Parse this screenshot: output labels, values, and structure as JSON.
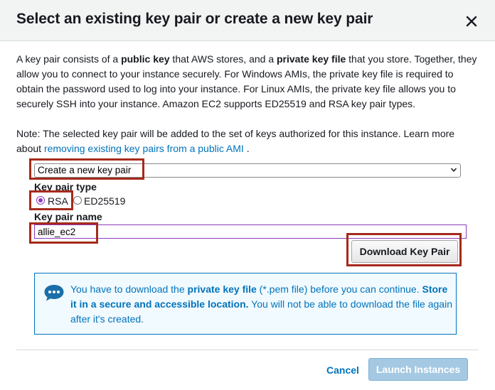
{
  "dialog": {
    "title": "Select an existing key pair or create a new key pair",
    "close_icon": "close-icon"
  },
  "description": {
    "p1_a": "A key pair consists of a ",
    "p1_b": "public key",
    "p1_c": " that AWS stores, and a ",
    "p1_d": "private key file",
    "p1_e": " that you store. Together, they allow you to connect to your instance securely. For Windows AMIs, the private key file is required to obtain the password used to log into your instance. For Linux AMIs, the private key file allows you to securely SSH into your instance. Amazon EC2 supports ED25519 and RSA key pair types."
  },
  "note": {
    "text": "Note: The selected key pair will be added to the set of keys authorized for this instance. Learn more about ",
    "link": "removing existing key pairs from a public AMI",
    "suffix": " ."
  },
  "key_pair_select": {
    "selected": "Create a new key pair"
  },
  "key_pair_type": {
    "label": "Key pair type",
    "options": [
      {
        "label": "RSA",
        "checked": true
      },
      {
        "label": "ED25519",
        "checked": false
      }
    ]
  },
  "key_pair_name": {
    "label": "Key pair name",
    "value": "allie_ec2"
  },
  "download_button": "Download Key Pair",
  "info": {
    "icon": "chat-bubble-icon",
    "t1": "You have to download the ",
    "t2": "private key file",
    "t3": " (*.pem file) before you can continue. ",
    "t4": "Store it in a secure and accessible location.",
    "t5": " You will not be able to download the file again after it's created."
  },
  "footer": {
    "cancel": "Cancel",
    "launch": "Launch Instances"
  },
  "colors": {
    "link": "#0073bb",
    "highlight": "#a52a1c",
    "radio_accent": "#8e3ab9",
    "info_bg": "#f1faff",
    "launch_disabled": "#a5c9e3"
  }
}
